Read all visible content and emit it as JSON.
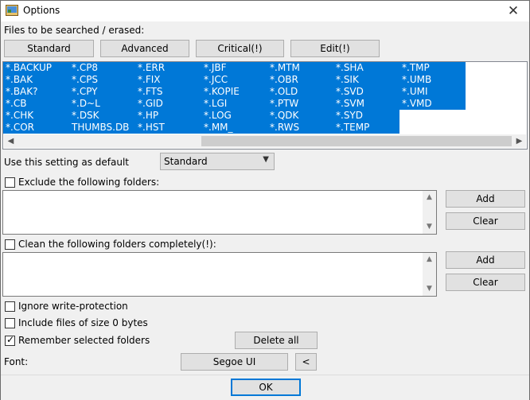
{
  "window": {
    "title": "Options",
    "close_glyph": "✕"
  },
  "files_section": {
    "label": "Files to be searched / erased:",
    "buttons": [
      "Standard",
      "Advanced",
      "Critical(!)",
      "Edit(!)"
    ]
  },
  "extensions": [
    [
      "*.BACKUP",
      "*.CP8",
      "*.ERR",
      "*.JBF",
      "*.MTM",
      "*.SHA",
      "*.TMP"
    ],
    [
      "*.BAK",
      "*.CPS",
      "*.FIX",
      "*.JCC",
      "*.OBR",
      "*.SIK",
      "*.UMB"
    ],
    [
      "*.BAK?",
      "*.CPY",
      "*.FTS",
      "*.KOPIE",
      "*.OLD",
      "*.SVD",
      "*.UMI"
    ],
    [
      "*.CB",
      "*.D~L",
      "*.GID",
      "*.LGI",
      "*.PTW",
      "*.SVM",
      "*.VMD"
    ],
    [
      "*.CHK",
      "*.DSK",
      "*.HP",
      "*.LOG",
      "*.QDK",
      "*.SYD",
      ""
    ],
    [
      "*.COR",
      "THUMBS.DB",
      "*.HST",
      "*.MM_",
      "*.RWS",
      "*.TEMP",
      ""
    ]
  ],
  "default_setting": {
    "label": "Use this setting as default",
    "value": "Standard"
  },
  "exclude": {
    "label": "Exclude the following folders:",
    "checked": false,
    "add": "Add",
    "clear": "Clear"
  },
  "clean": {
    "label": "Clean the following folders completely(!):",
    "checked": false,
    "add": "Add",
    "clear": "Clear"
  },
  "options": [
    {
      "label": "Ignore write-protection",
      "checked": false
    },
    {
      "label": "Include files of size 0 bytes",
      "checked": false
    },
    {
      "label": "Remember selected folders",
      "checked": true
    }
  ],
  "delete_all": "Delete all",
  "font": {
    "label": "Font:",
    "value": "Segoe UI",
    "btn": "<"
  },
  "ok": "OK"
}
